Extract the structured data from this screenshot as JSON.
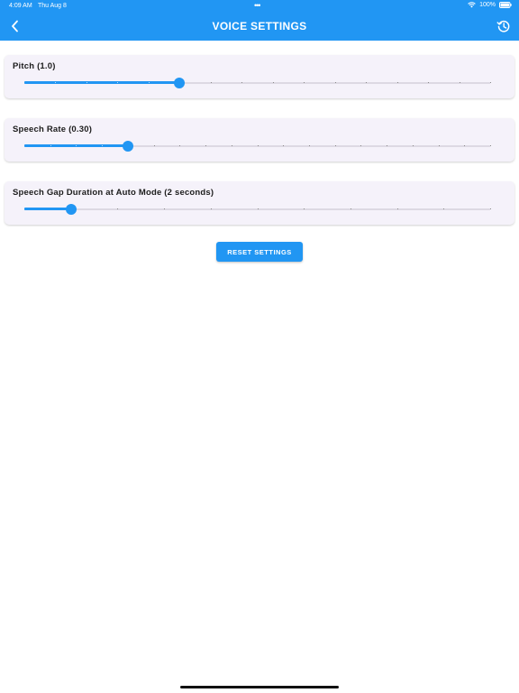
{
  "status_bar": {
    "time": "4:09 AM",
    "date": "Thu Aug 8",
    "dots": "•••",
    "battery": "100%"
  },
  "nav": {
    "title": "VOICE SETTINGS",
    "back_icon": "chevron-left-icon",
    "history_icon": "history-icon"
  },
  "settings": [
    {
      "label": "Pitch (1.0)",
      "value_fraction": 0.333,
      "tick_count": 15
    },
    {
      "label": "Speech Rate (0.30)",
      "value_fraction": 0.222,
      "tick_count": 18
    },
    {
      "label": "Speech Gap Duration at Auto Mode (2 seconds)",
      "value_fraction": 0.1,
      "tick_count": 10
    }
  ],
  "reset_button": {
    "label": "RESET SETTINGS"
  },
  "colors": {
    "accent": "#2196f3",
    "card_bg": "#f5f2fa"
  }
}
